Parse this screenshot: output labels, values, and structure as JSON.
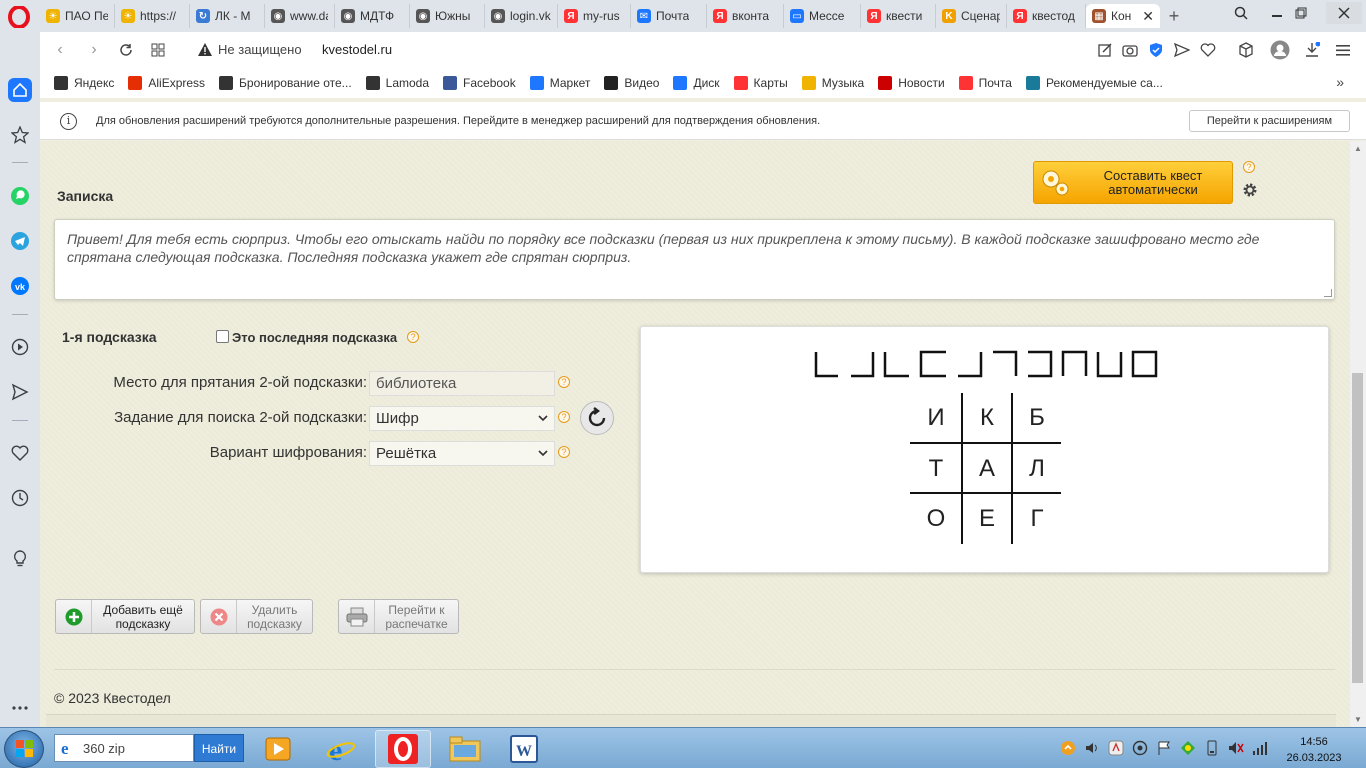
{
  "browser": {
    "tabs": [
      {
        "label": "ПАО Пе",
        "icon": "sun-icon",
        "color": "#f0b400"
      },
      {
        "label": "https://",
        "icon": "sun-icon",
        "color": "#f0b400"
      },
      {
        "label": "ЛК - М",
        "icon": "refresh-icon",
        "color": "#3a7bd5"
      },
      {
        "label": "www.da",
        "icon": "globe-icon",
        "color": "#555555"
      },
      {
        "label": "МДТФ",
        "icon": "globe-icon",
        "color": "#555555"
      },
      {
        "label": "Южны",
        "icon": "globe-icon",
        "color": "#555555"
      },
      {
        "label": "login.vk",
        "icon": "globe-icon",
        "color": "#555555"
      },
      {
        "label": "my-rus",
        "icon": "yandex-icon",
        "color": "#f33"
      },
      {
        "label": "Почта",
        "icon": "mail-icon",
        "color": "#1e78ff"
      },
      {
        "label": "вконта",
        "icon": "yandex-icon",
        "color": "#f33"
      },
      {
        "label": "Мессе",
        "icon": "chat-icon",
        "color": "#1e78ff"
      },
      {
        "label": "квести",
        "icon": "yandex-icon",
        "color": "#f33"
      },
      {
        "label": "Сценар",
        "icon": "k-icon",
        "color": "#f0a000"
      },
      {
        "label": "квестод",
        "icon": "yandex-icon",
        "color": "#f33"
      },
      {
        "label": "Кон",
        "icon": "puzzle-icon",
        "color": "#a0522d"
      }
    ],
    "security_label": "Не защищено",
    "url": "kvestodel.ru",
    "bookmarks": [
      {
        "label": "Яндекс",
        "color": "#333"
      },
      {
        "label": "AliExpress",
        "color": "#e62e04"
      },
      {
        "label": "Бронирование оте...",
        "color": "#333"
      },
      {
        "label": "Lamoda",
        "color": "#333"
      },
      {
        "label": "Facebook",
        "color": "#3b5998"
      },
      {
        "label": "Маркет",
        "color": "#1e78ff"
      },
      {
        "label": "Видео",
        "color": "#222"
      },
      {
        "label": "Диск",
        "color": "#1e78ff"
      },
      {
        "label": "Карты",
        "color": "#f33"
      },
      {
        "label": "Музыка",
        "color": "#f0b400"
      },
      {
        "label": "Новости",
        "color": "#c00"
      },
      {
        "label": "Почта",
        "color": "#f33"
      },
      {
        "label": "Рекомендуемые са...",
        "color": "#1a7a9a"
      }
    ],
    "infobar": {
      "message": "Для обновления расширений требуются дополнительные разрешения. Перейдите в менеджер расширений для подтверждения обновления.",
      "button": "Перейти к расширениям"
    }
  },
  "page": {
    "note_heading": "Записка",
    "auto_button": "Составить квест автоматически",
    "note_text": "Привет! Для тебя есть сюрприз. Чтобы его отыскать найди по порядку все подсказки (первая из них прикреплена к этому письму). В каждой подсказке зашифровано место где спрятана следующая подсказка. Последняя подсказка укажет где спрятан сюрприз.",
    "hint_heading": "1-я подсказка",
    "last_hint_label": "Это последняя подсказка",
    "fields": {
      "place_label": "Место для прятания 2-ой подсказки:",
      "place_value": "библиотека",
      "task_label": "Задание для поиска 2-ой подсказки:",
      "task_value": "Шифр",
      "cipher_label": "Вариант шифрования:",
      "cipher_value": "Решётка"
    },
    "grid_letters": [
      "И",
      "К",
      "Б",
      "Т",
      "А",
      "Л",
      "О",
      "Е",
      "Г"
    ],
    "buttons": {
      "add": "Добавить ещё подсказку",
      "delete": "Удалить подсказку",
      "print": "Перейти к распечатке"
    },
    "footer": "© 2023 Квестодел"
  },
  "taskbar": {
    "search_text": "360 zip",
    "search_button": "Найти",
    "time": "14:56",
    "date": "26.03.2023"
  }
}
